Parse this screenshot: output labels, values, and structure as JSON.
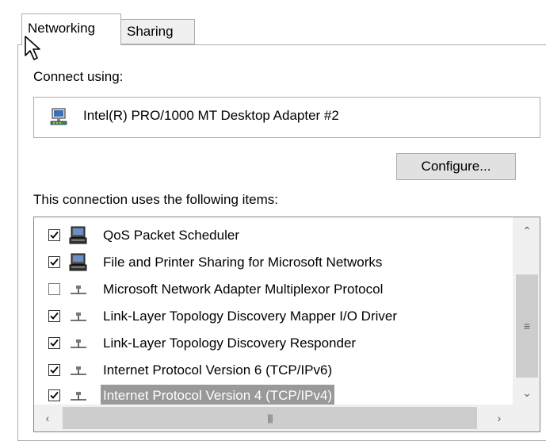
{
  "tabs": [
    {
      "label": "Networking",
      "active": true
    },
    {
      "label": "Sharing",
      "active": false
    }
  ],
  "connect_using": {
    "label": "Connect using:",
    "adapter_name": "Intel(R) PRO/1000 MT Desktop Adapter #2",
    "adapter_icon": "network-adapter-icon"
  },
  "configure_button": {
    "label": "Configure..."
  },
  "items_section": {
    "label": "This connection uses the following items:",
    "items": [
      {
        "label": "QoS Packet Scheduler",
        "checked": true,
        "icon": "network-client-icon",
        "selected": false
      },
      {
        "label": "File and Printer Sharing for Microsoft Networks",
        "checked": true,
        "icon": "network-client-icon",
        "selected": false
      },
      {
        "label": "Microsoft Network Adapter Multiplexor Protocol",
        "checked": false,
        "icon": "protocol-icon",
        "selected": false
      },
      {
        "label": "Link-Layer Topology Discovery Mapper I/O Driver",
        "checked": true,
        "icon": "protocol-icon",
        "selected": false
      },
      {
        "label": "Link-Layer Topology Discovery Responder",
        "checked": true,
        "icon": "protocol-icon",
        "selected": false
      },
      {
        "label": "Internet Protocol Version 6 (TCP/IPv6)",
        "checked": true,
        "icon": "protocol-icon",
        "selected": false
      },
      {
        "label": "Internet Protocol Version 4 (TCP/IPv4)",
        "checked": true,
        "icon": "protocol-icon",
        "selected": true
      }
    ]
  },
  "colors": {
    "selection": "#999999",
    "border": "#adadad",
    "button_bg": "#e1e1e1",
    "scrollbar_bg": "#f0f0f0",
    "scrollbar_thumb": "#cdcdcd"
  }
}
